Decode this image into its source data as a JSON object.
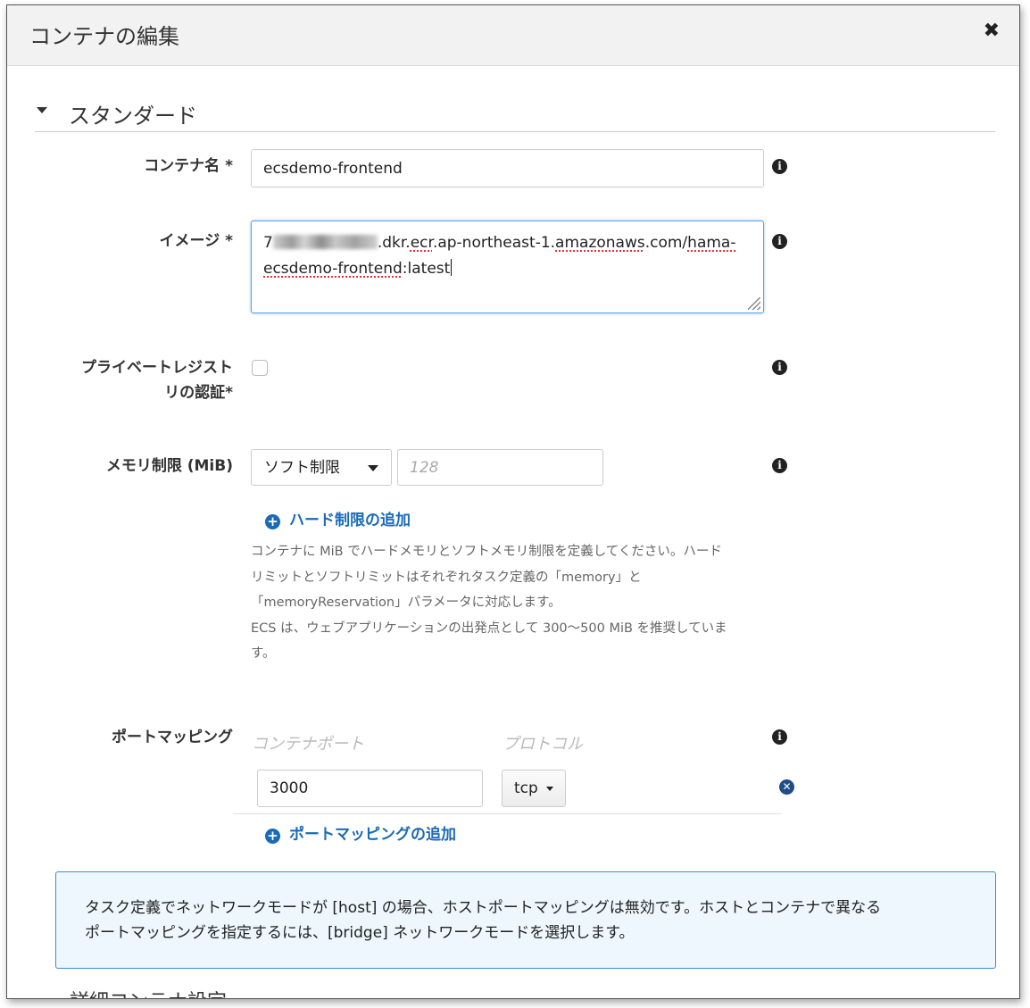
{
  "dialog": {
    "title": "コンテナの編集",
    "close_label": "✖"
  },
  "section": {
    "title": "スタンダード"
  },
  "fields": {
    "container_name": {
      "label": "コンテナ名 *",
      "value": "ecsdemo-frontend"
    },
    "image": {
      "label": "イメージ *",
      "value_lead": "7",
      "value_part1": ".dkr.",
      "value_part2": "ecr",
      "value_part3": ".ap-northeast-1.",
      "value_part4": "amazonaws",
      "value_part5": ".com/",
      "value_part6": "hama-",
      "value_part7": "ecsdemo-frontend",
      "value_part8": ":latest"
    },
    "private_registry": {
      "label_line1": "プライベートレジスト",
      "label_line2": "リの認証*",
      "checked": false
    },
    "memory": {
      "label": "メモリ制限 (MiB)",
      "limit_type": "ソフト制限",
      "placeholder": "128",
      "add_hard_limit": "ハード制限の追加",
      "help_line1": "コンテナに MiB でハードメモリとソフトメモリ制限を定義してください。ハード",
      "help_line2": "リミットとソフトリミットはそれぞれタスク定義の「memory」と",
      "help_line3": "「memoryReservation」パラメータに対応します。",
      "help_line4": "ECS は、ウェブアプリケーションの出発点として 300〜500 MiB を推奨していま",
      "help_line5": "す。"
    },
    "port_mapping": {
      "label": "ポートマッピング",
      "col_container_port": "コンテナポート",
      "col_protocol": "プロトコル",
      "rows": [
        {
          "port": "3000",
          "protocol": "tcp"
        }
      ],
      "add_label": "ポートマッピングの追加"
    }
  },
  "notice": {
    "line1": "タスク定義でネットワークモードが [host] の場合、ホストポートマッピングは無効です。ホストとコンテナで異なる",
    "line2": "ポートマッピングを指定するには、[bridge] ネットワークモードを選択します。"
  },
  "next_section": {
    "title": "詳細コンテナ設定"
  },
  "icons": {
    "info": "info-icon",
    "close": "close-icon",
    "add": "plus-circle-icon",
    "remove": "remove-circle-icon",
    "collapse": "triangle-down-icon"
  },
  "colors": {
    "link": "#1a6ab8",
    "focus_border": "#5aa0e6",
    "notice_border": "#3b8dd6",
    "notice_bg": "#eef7fd"
  }
}
